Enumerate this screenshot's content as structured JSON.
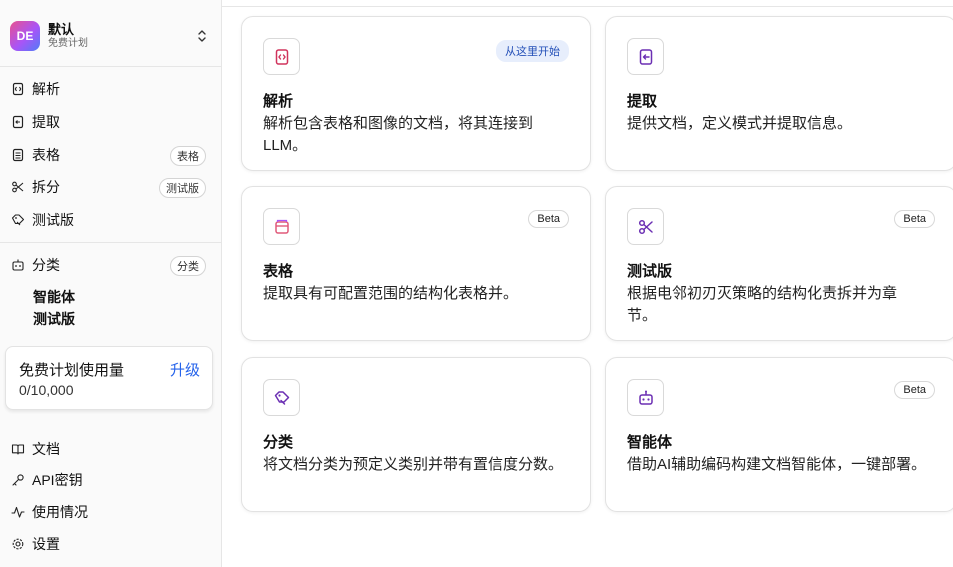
{
  "workspace": {
    "avatar_initials": "DE",
    "name": "默认",
    "plan": "免费计划"
  },
  "nav": {
    "items": [
      {
        "label": "解析",
        "icon": "parse-icon"
      },
      {
        "label": "提取",
        "icon": "extract-icon"
      },
      {
        "label": "表格",
        "icon": "table-icon",
        "badge": "表格"
      },
      {
        "label": "拆分",
        "icon": "scissors-icon",
        "badge": "测试版"
      },
      {
        "label": "测试版",
        "icon": "tag-icon"
      },
      {
        "label": "分类",
        "icon": "classify-icon",
        "badge": "分类"
      }
    ],
    "sub_item_line1": "智能体",
    "sub_item_line2": "测试版"
  },
  "usage": {
    "title": "免费计划使用量",
    "upgrade_label": "升级",
    "count": "0/10,000"
  },
  "footer_nav": [
    {
      "label": "文档",
      "icon": "book-icon"
    },
    {
      "label": "API密钥",
      "icon": "key-icon"
    },
    {
      "label": "使用情况",
      "icon": "activity-icon"
    },
    {
      "label": "设置",
      "icon": "gear-icon"
    }
  ],
  "cards": [
    {
      "title": "解析",
      "description": "解析包含表格和图像的文档，将其连接到LLM。",
      "badge": "从这里开始",
      "icon": "parse-icon",
      "icon_color": "#d0335c"
    },
    {
      "title": "提取",
      "description": "提供文档，定义模式并提取信息。",
      "badge": "",
      "icon": "extract-icon",
      "icon_color": "#6b2fb3"
    },
    {
      "title": "表格",
      "description": "提取具有可配置范围的结构化表格并。",
      "badge": "Beta",
      "icon": "table-icon",
      "icon_color": "#e05a7a"
    },
    {
      "title": "测试版",
      "description": "根据电邻初刃灭策略的结构化责拆并为章节。",
      "badge": "Beta",
      "icon": "scissors-icon",
      "icon_color": "#6b2fb3"
    },
    {
      "title": "分类",
      "description": "将文档分类为预定义类别并带有置信度分数。",
      "badge": "",
      "icon": "tag-icon",
      "icon_color": "#6b2fb3"
    },
    {
      "title": "智能体",
      "description": "借助AI辅助编码构建文档智能体，一键部署。",
      "badge": "Beta",
      "icon": "robot-icon",
      "icon_color": "#6b2fb3"
    }
  ],
  "colors": {
    "accent": "#2563eb",
    "badge_start_bg": "#e7eefc"
  }
}
